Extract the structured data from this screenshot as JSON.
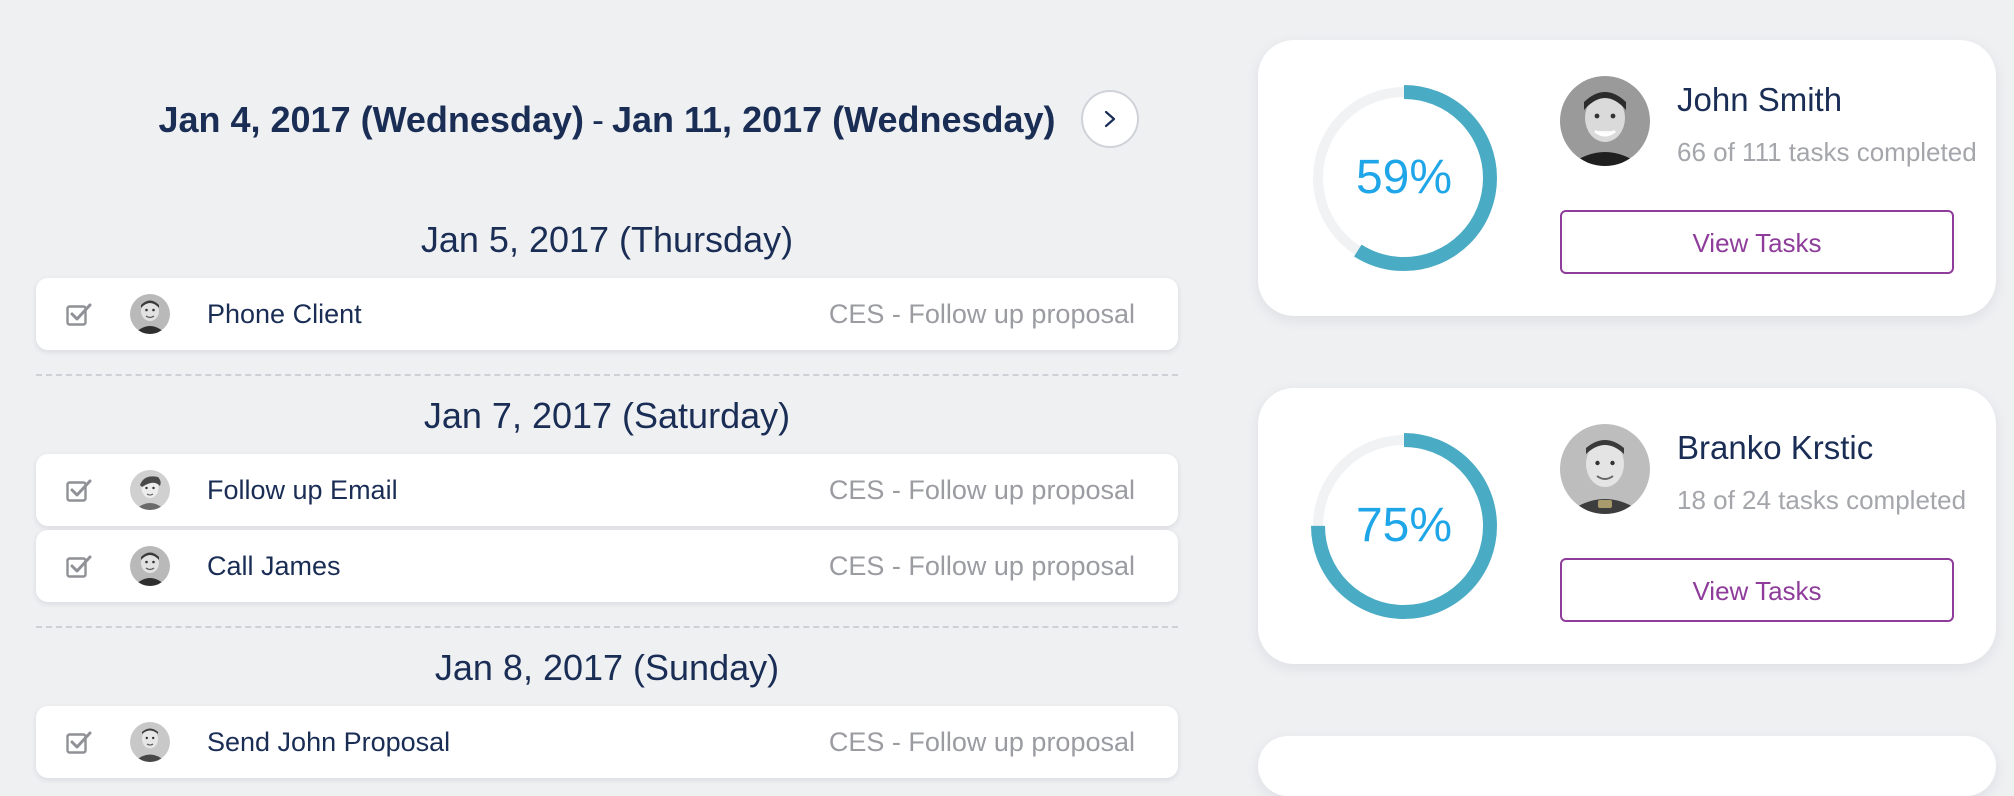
{
  "header": {
    "range_start": "Jan 4, 2017 (Wednesday)",
    "range_separator": "-",
    "range_end": "Jan 11, 2017 (Wednesday)",
    "next_icon": "chevron-right-icon"
  },
  "days": [
    {
      "heading": "Jan 5, 2017 (Thursday)",
      "tasks": [
        {
          "name": "Phone Client",
          "project": "CES - Follow up proposal",
          "checked": true
        }
      ]
    },
    {
      "heading": "Jan 7, 2017 (Saturday)",
      "tasks": [
        {
          "name": "Follow up Email",
          "project": "CES - Follow up proposal",
          "checked": true
        },
        {
          "name": "Call James",
          "project": "CES - Follow up proposal",
          "checked": true
        }
      ]
    },
    {
      "heading": "Jan 8, 2017 (Sunday)",
      "tasks": [
        {
          "name": "Send John Proposal",
          "project": "CES - Follow up proposal",
          "checked": true
        }
      ]
    }
  ],
  "members": [
    {
      "name": "John Smith",
      "percent_label": "59%",
      "percent": 59,
      "progress_text": "66 of 111 tasks completed",
      "button_label": "View Tasks"
    },
    {
      "name": "Branko Krstic",
      "percent_label": "75%",
      "percent": 75,
      "progress_text": "18 of 24 tasks completed",
      "button_label": "View Tasks"
    }
  ],
  "colors": {
    "background": "#eff0f2",
    "heading_text": "#1a2d55",
    "muted_text": "#9a9ca2",
    "donut_fill": "#4aabc4",
    "donut_track": "#f1f2f4",
    "percent_text": "#1fa6e8",
    "button_accent": "#8e3d9a"
  }
}
